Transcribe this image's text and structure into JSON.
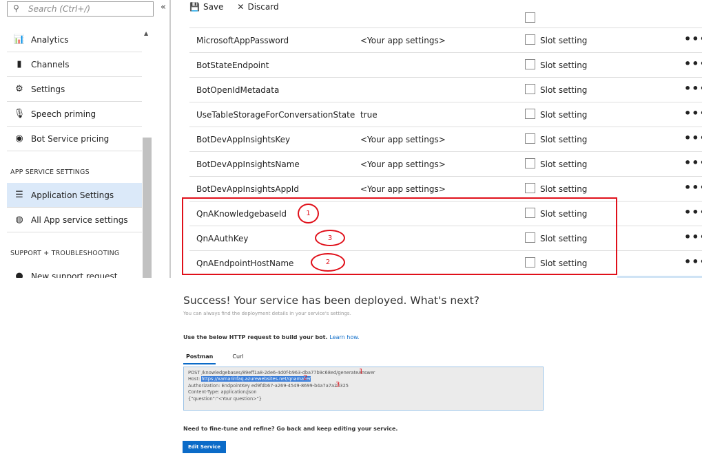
{
  "sidebar": {
    "search_placeholder": "Search (Ctrl+/)",
    "collapse": "«",
    "items": [
      {
        "label": "Analytics",
        "icon": "chart-icon",
        "glyph": "📊"
      },
      {
        "label": "Channels",
        "icon": "channels-icon",
        "glyph": "▮"
      },
      {
        "label": "Settings",
        "icon": "gear-icon",
        "glyph": "⚙"
      },
      {
        "label": "Speech priming",
        "icon": "microphone-icon",
        "glyph": "🎙"
      },
      {
        "label": "Bot Service pricing",
        "icon": "pricing-icon",
        "glyph": "◉"
      }
    ],
    "section1": "APP SERVICE SETTINGS",
    "items2": [
      {
        "label": "Application Settings",
        "icon": "list-icon",
        "glyph": "☰"
      },
      {
        "label": "All App service settings",
        "icon": "app-service-icon",
        "glyph": "◍"
      }
    ],
    "section2": "SUPPORT + TROUBLESHOOTING",
    "items3": [
      {
        "label": "New support request",
        "icon": "support-icon",
        "glyph": "●"
      }
    ]
  },
  "toolbar": {
    "save": "Save",
    "discard": "Discard"
  },
  "settings": {
    "slot_label": "Slot setting",
    "more": "•••",
    "rows": [
      {
        "name": "MicrosoftAppPassword",
        "value": "<Your app settings>"
      },
      {
        "name": "BotStateEndpoint",
        "value": ""
      },
      {
        "name": "BotOpenIdMetadata",
        "value": ""
      },
      {
        "name": "UseTableStorageForConversationState",
        "value": "true"
      },
      {
        "name": "BotDevAppInsightsKey",
        "value": "<Your app settings>"
      },
      {
        "name": "BotDevAppInsightsName",
        "value": "<Your app settings>"
      },
      {
        "name": "BotDevAppInsightsAppId",
        "value": "<Your app settings>"
      },
      {
        "name": "QnAKnowledgebaseId",
        "value": ""
      },
      {
        "name": "QnAAuthKey",
        "value": ""
      },
      {
        "name": "QnAEndpointHostName",
        "value": ""
      }
    ]
  },
  "annotations": {
    "a1": "1",
    "a2": "2",
    "a3": "3",
    "color": "#e0101a"
  },
  "deploy": {
    "title": "Success! Your service has been deployed. What's next?",
    "subtitle": "You can always find the deployment details in your service's settings.",
    "use_text": "Use the below HTTP request to build your bot.",
    "learn": "Learn how.",
    "tabs": [
      "Postman",
      "Curl"
    ],
    "code": {
      "line1": "POST /knowledgebases/89eff1a8-2de6-4d0f-b963-dba77b9c68ed/generateAnswer",
      "host_label": "Host: ",
      "host": "https://xamarinfaq.azurewebsites.net/qnamaker",
      "line3": "Authorization: EndpointKey ed9fdb67-a269-4549-8699-b4a7a7a24325",
      "line4": "Content-Type: application/json",
      "line5": "{\"question\":\"<Your question>\"}"
    },
    "fine_tune": "Need to fine-tune and refine? Go back and keep editing your service.",
    "edit_button": "Edit Service"
  }
}
